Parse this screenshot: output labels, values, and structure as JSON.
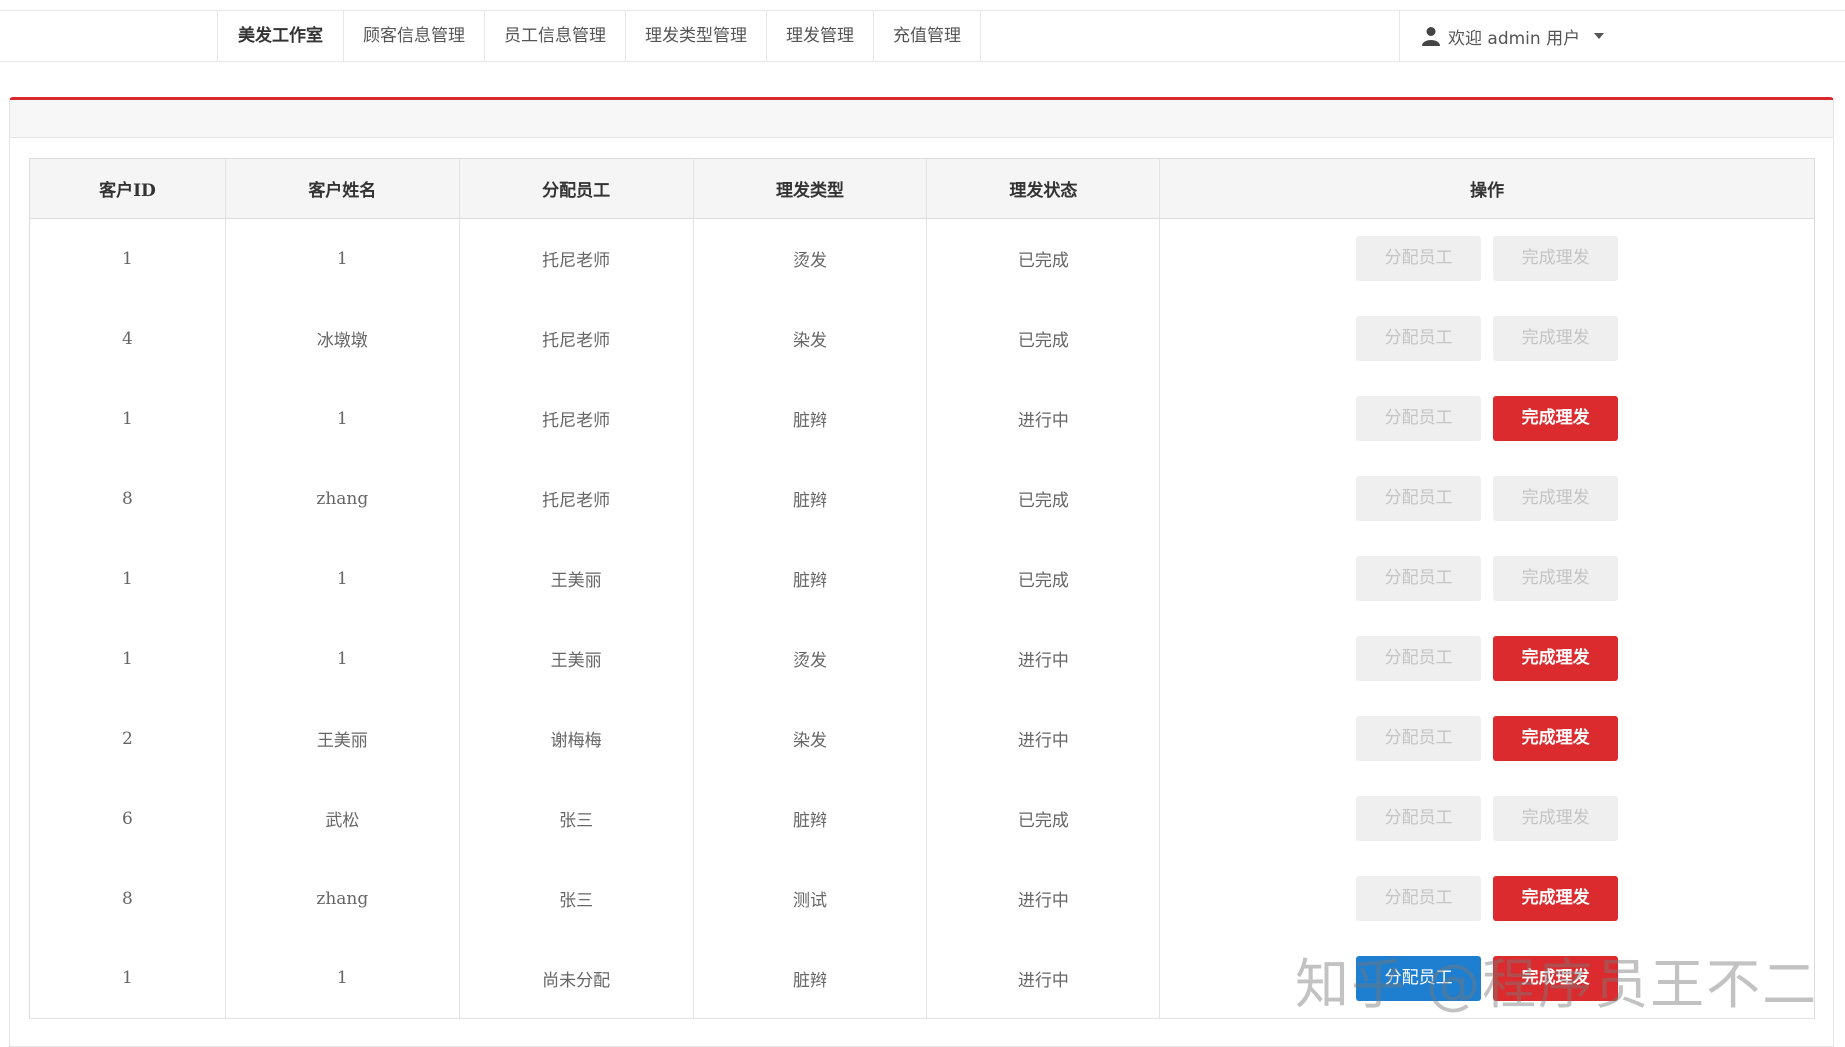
{
  "nav": {
    "brand": "美发工作室",
    "items": [
      "顾客信息管理",
      "员工信息管理",
      "理发类型管理",
      "理发管理",
      "充值管理"
    ]
  },
  "user": {
    "label": "欢迎 admin 用户",
    "icon": "user-icon"
  },
  "colors": {
    "accent": "#dc2b2e",
    "blue": "#1e7fd0",
    "disabled_bg": "#efefef"
  },
  "table": {
    "headers": [
      "客户ID",
      "客户姓名",
      "分配员工",
      "理发类型",
      "理发状态",
      "操作"
    ],
    "assign_label": "分配员工",
    "finish_label": "完成理发",
    "rows": [
      {
        "id": "1",
        "name": "1",
        "staff": "托尼老师",
        "type": "烫发",
        "status": "已完成"
      },
      {
        "id": "4",
        "name": "冰墩墩",
        "staff": "托尼老师",
        "type": "染发",
        "status": "已完成"
      },
      {
        "id": "1",
        "name": "1",
        "staff": "托尼老师",
        "type": "脏辫",
        "status": "进行中"
      },
      {
        "id": "8",
        "name": "zhang",
        "staff": "托尼老师",
        "type": "脏辫",
        "status": "已完成"
      },
      {
        "id": "1",
        "name": "1",
        "staff": "王美丽",
        "type": "脏辫",
        "status": "已完成"
      },
      {
        "id": "1",
        "name": "1",
        "staff": "王美丽",
        "type": "烫发",
        "status": "进行中"
      },
      {
        "id": "2",
        "name": "王美丽",
        "staff": "谢梅梅",
        "type": "染发",
        "status": "进行中"
      },
      {
        "id": "6",
        "name": "武松",
        "staff": "张三",
        "type": "脏辫",
        "status": "已完成"
      },
      {
        "id": "8",
        "name": "zhang",
        "staff": "张三",
        "type": "测试",
        "status": "进行中"
      },
      {
        "id": "1",
        "name": "1",
        "staff": "尚未分配",
        "type": "脏辫",
        "status": "进行中"
      }
    ]
  },
  "watermark": "知乎 @程序员王不二"
}
